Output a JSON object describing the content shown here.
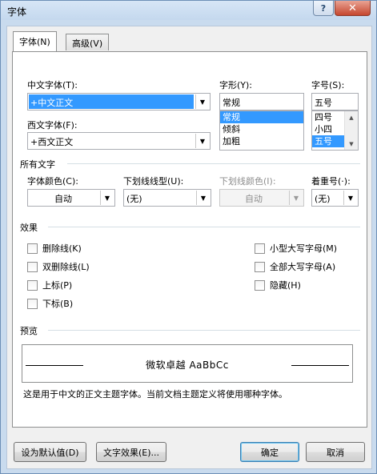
{
  "window": {
    "title": "字体",
    "help_glyph": "?",
    "close_glyph": "✕"
  },
  "tabs": [
    {
      "label": "字体(N)"
    },
    {
      "label": "高级(V)"
    }
  ],
  "font": {
    "chinese_label": "中文字体(T):",
    "chinese_value": "+中文正文",
    "western_label": "西文字体(F):",
    "western_value": "+西文正文",
    "style_label": "字形(Y):",
    "style_value": "常规",
    "style_options": [
      "常规",
      "倾斜",
      "加粗"
    ],
    "style_selected": "常规",
    "size_label": "字号(S):",
    "size_value": "五号",
    "size_options": [
      "四号",
      "小四",
      "五号"
    ],
    "size_selected": "五号"
  },
  "all_text": {
    "heading": "所有文字",
    "font_color_label": "字体颜色(C):",
    "font_color_value": "自动",
    "underline_style_label": "下划线线型(U):",
    "underline_style_value": "(无)",
    "underline_color_label": "下划线颜色(I):",
    "underline_color_value": "自动",
    "emphasis_label": "着重号(·):",
    "emphasis_value": "(无)"
  },
  "effects": {
    "heading": "效果",
    "strikethrough": "删除线(K)",
    "double_strikethrough": "双删除线(L)",
    "superscript": "上标(P)",
    "subscript": "下标(B)",
    "small_caps": "小型大写字母(M)",
    "all_caps": "全部大写字母(A)",
    "hidden": "隐藏(H)"
  },
  "preview": {
    "heading": "预览",
    "sample": "微软卓越  AaBbCc",
    "description": "这是用于中文的正文主题字体。当前文档主题定义将使用哪种字体。"
  },
  "buttons": {
    "set_default": "设为默认值(D)",
    "text_effects": "文字效果(E)...",
    "ok": "确定",
    "cancel": "取消"
  }
}
